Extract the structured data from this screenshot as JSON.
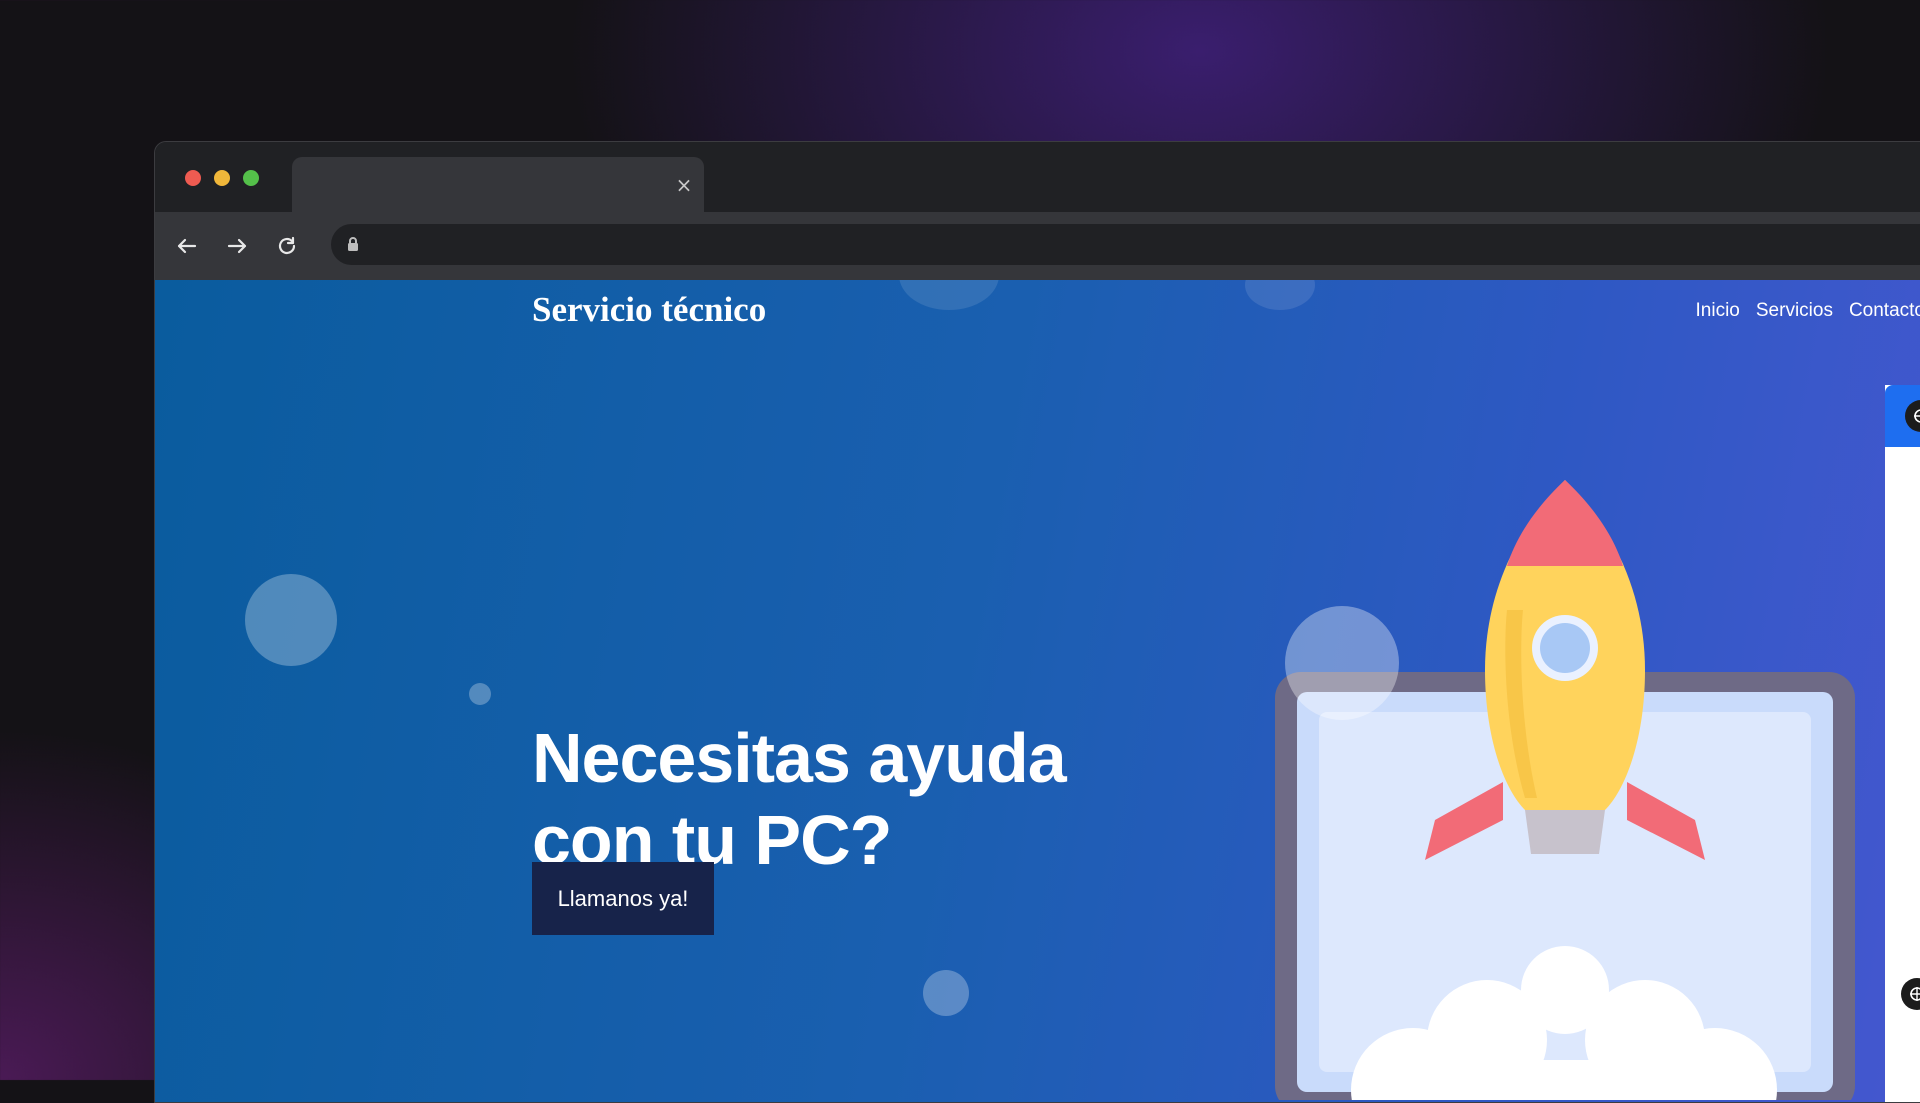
{
  "browser": {
    "tab": {
      "title": "",
      "close_glyph": "×"
    },
    "toolbar": {
      "back_icon": "arrow-left-icon",
      "forward_icon": "arrow-right-icon",
      "reload_icon": "reload-icon"
    },
    "address": {
      "url": "",
      "lock_icon": "lock-icon"
    },
    "traffic_colors": {
      "close": "#ee5b51",
      "minimize": "#f0b73a",
      "zoom": "#54c04a"
    }
  },
  "site": {
    "brand": "Servicio técnico",
    "nav": [
      {
        "label": "Inicio"
      },
      {
        "label": "Servicios"
      },
      {
        "label": "Contacto"
      }
    ],
    "hero": {
      "title": "Necesitas ayuda con tu PC?",
      "cta_label": "Llamanos ya!"
    },
    "side_widget": {
      "icon": "brain-gear-icon"
    },
    "colors": {
      "gradient_start": "#0a5c9e",
      "gradient_end": "#4657d0",
      "cta_background": "#17234a",
      "widget_accent": "#1e6ef0"
    }
  }
}
